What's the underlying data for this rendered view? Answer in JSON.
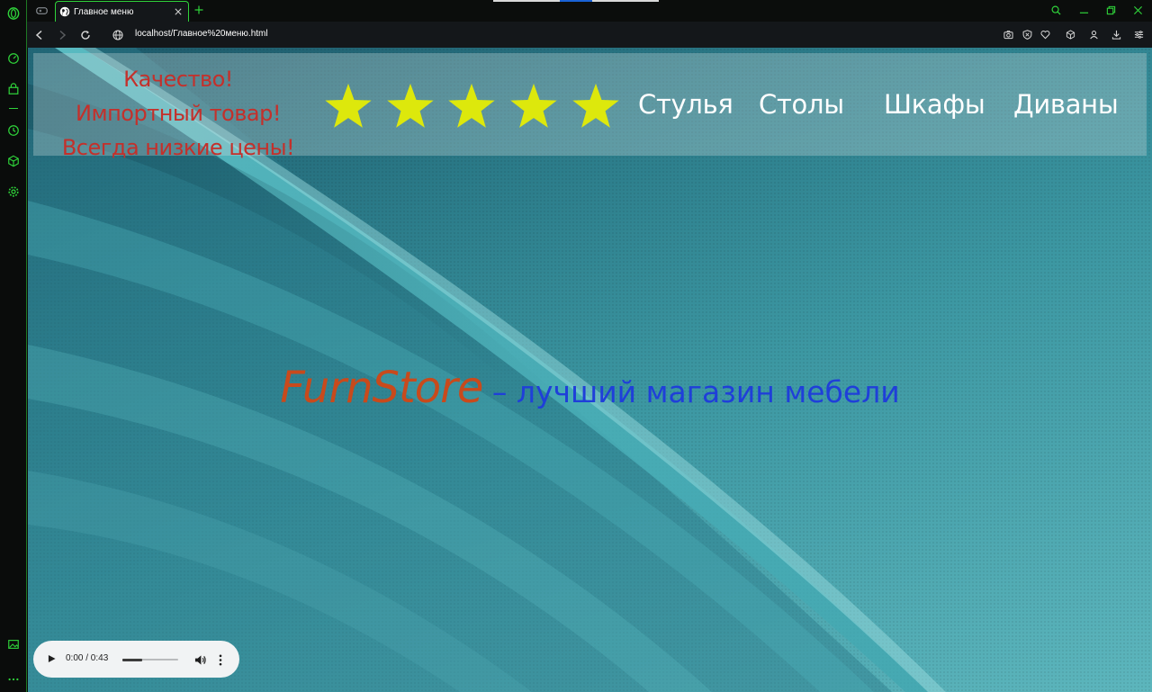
{
  "colors": {
    "accent": "#2fd33a",
    "slogan": "#c4302b",
    "star": "#dde80c",
    "brand": "#c84a1c",
    "tagline": "#1f3fd9",
    "menu": "#ffffff"
  },
  "browser": {
    "tab": {
      "title": "Главное меню",
      "favicon": "globe-icon"
    },
    "url": "localhost/Главное%20меню.html",
    "sidebar_icons": [
      "browser-logo-icon",
      "speed-dial-icon",
      "shopping-bag-icon",
      "history-icon",
      "extensions-cube-icon",
      "settings-gear-icon",
      "gallery-icon",
      "more-dots-icon"
    ],
    "toolbar_icons": [
      "camera-snapshot-icon",
      "shield-icon",
      "heart-icon",
      "cube-icon",
      "profile-icon",
      "download-icon",
      "easy-setup-icon"
    ]
  },
  "header": {
    "slogan_lines": [
      "Качество!",
      "Импортный товар!",
      "Всегда низкие цены!"
    ],
    "rating": {
      "stars": 5,
      "max": 5
    },
    "menu": [
      "Стулья",
      "Столы",
      "Шкафы",
      "Диваны"
    ]
  },
  "hero": {
    "brand": "FurnStore",
    "tagline": " – лучший магазин мебели"
  },
  "audio": {
    "time": "0:00 / 0:43",
    "progress": 0.35
  }
}
